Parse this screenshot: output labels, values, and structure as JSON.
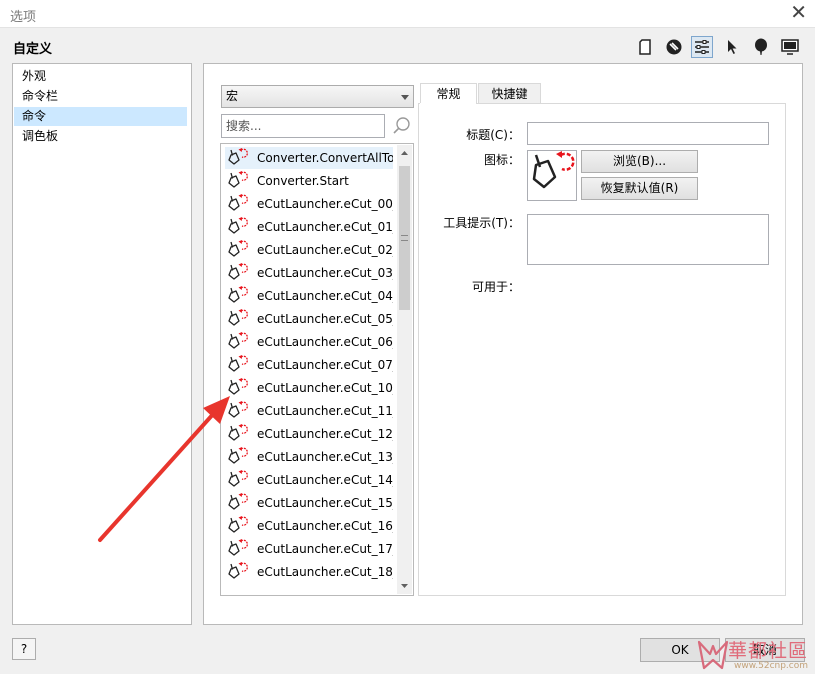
{
  "window": {
    "title": "选项",
    "close_glyph": "✕"
  },
  "section_heading": "自定义",
  "toolbar_icons": [
    "page-icon",
    "fill-icon",
    "settings-sliders-icon",
    "pointer-icon",
    "balloon-icon",
    "monitor-icon"
  ],
  "nav": {
    "items": [
      {
        "label": "外观"
      },
      {
        "label": "命令栏"
      },
      {
        "label": "命令",
        "selected": true
      },
      {
        "label": "调色板"
      }
    ]
  },
  "category_select": {
    "value": "宏"
  },
  "search": {
    "placeholder": "搜索..."
  },
  "command_list": {
    "items": [
      "Converter.ConvertAllTo...",
      "Converter.Start",
      "eCutLauncher.eCut_00_...",
      "eCutLauncher.eCut_01_...",
      "eCutLauncher.eCut_02_...",
      "eCutLauncher.eCut_03_...",
      "eCutLauncher.eCut_04_...",
      "eCutLauncher.eCut_05_...",
      "eCutLauncher.eCut_06_...",
      "eCutLauncher.eCut_07_...",
      "eCutLauncher.eCut_10_...",
      "eCutLauncher.eCut_11_...",
      "eCutLauncher.eCut_12_...",
      "eCutLauncher.eCut_13_...",
      "eCutLauncher.eCut_14_...",
      "eCutLauncher.eCut_15_...",
      "eCutLauncher.eCut_16_...",
      "eCutLauncher.eCut_17_...",
      "eCutLauncher.eCut_18_..."
    ]
  },
  "tabs": [
    {
      "label": "常规"
    },
    {
      "label": "快捷键"
    }
  ],
  "form": {
    "title_label": "标题(C)：",
    "icon_label": "图标：",
    "browse_button": "浏览(B)...",
    "reset_button": "恢复默认值(R)",
    "tooltip_label": "工具提示(T)：",
    "available_label": "可用于："
  },
  "footer": {
    "help_label": "?",
    "ok_label": "OK",
    "cancel_label": "取消"
  },
  "watermark": {
    "text": "華都社區",
    "url": "www.52cnp.com"
  },
  "colors": {
    "selection": "#cce8ff",
    "annotation_arrow": "#e8352d",
    "icon_accent": "#e8141c"
  }
}
